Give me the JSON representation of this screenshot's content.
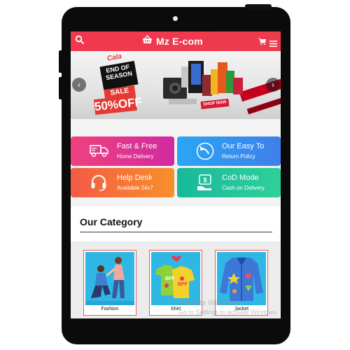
{
  "app": {
    "title": "Mz E-com"
  },
  "header": {
    "icons": {
      "search": "search-icon",
      "logo": "basket-icon",
      "cart": "cart-icon",
      "menu": "menu-icon"
    }
  },
  "banner": {
    "brand_tag": "Cala",
    "headline": "END OF SEASON",
    "sale_label": "SALE",
    "discount": "50%OFF",
    "cta": "SHOP NOW",
    "prev_icon": "chevron-left-icon",
    "next_icon": "chevron-right-icon"
  },
  "services": [
    {
      "title": "Fast & Free",
      "subtitle": "Home Delivery",
      "icon": "truck-icon",
      "color": "#e23a8e"
    },
    {
      "title": "Our Easy To",
      "subtitle": "Return Policy",
      "icon": "return-arrow-icon",
      "color": "#3590f0"
    },
    {
      "title": "Help Desk",
      "subtitle": "Available 24x7",
      "icon": "headset-icon",
      "color": "#f6763a"
    },
    {
      "title": "CoD Mode",
      "subtitle": "Cash on Delivery",
      "icon": "cash-icon",
      "color": "#22c49a"
    }
  ],
  "category": {
    "heading": "Our Category",
    "items": [
      {
        "label": "Fashion",
        "icon": "fashion-couple-icon"
      },
      {
        "label": "Shirt",
        "icon": "shirt-icon"
      },
      {
        "label": "Jacket",
        "icon": "jacket-icon"
      }
    ]
  },
  "watermark": {
    "line1": "Activate Windows",
    "line2": "Go to Settings to activate Windows."
  },
  "colors": {
    "brand_red": "#ef394e",
    "card_blue": "#2fb7e6",
    "frame": "#0b0b0b"
  }
}
